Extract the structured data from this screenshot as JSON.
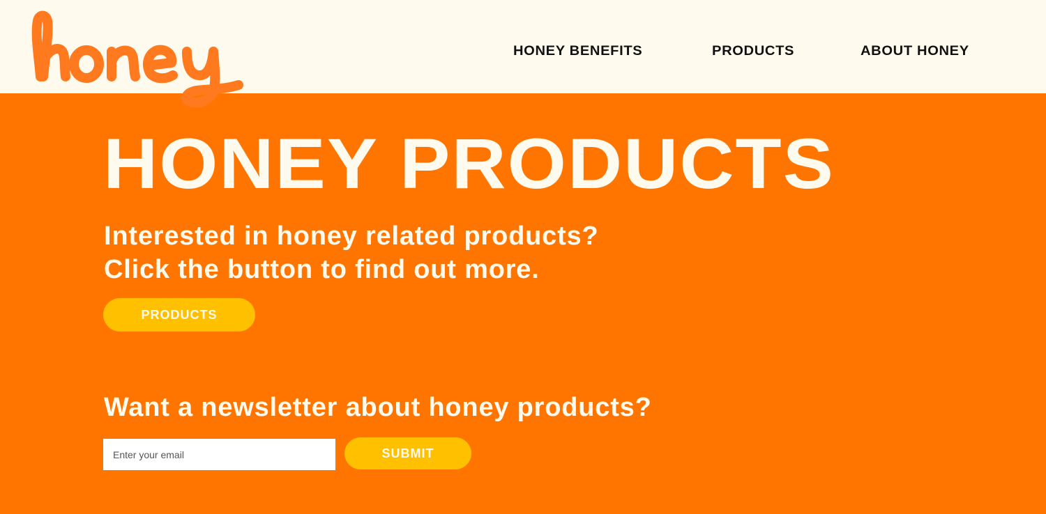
{
  "brand": {
    "logo_text": "honey",
    "logo_color": "#ff7a1f"
  },
  "nav": {
    "items": [
      {
        "label": "HONEY BENEFITS"
      },
      {
        "label": "PRODUCTS"
      },
      {
        "label": "ABOUT HONEY"
      }
    ]
  },
  "hero": {
    "title": "HONEY PRODUCTS",
    "subtitle_line1": "Interested in honey related products?",
    "subtitle_line2": "Click the button to find out more.",
    "button_label": "PRODUCTS"
  },
  "newsletter": {
    "title": "Want a newsletter about honey products?",
    "email_placeholder": "Enter your email",
    "email_value": "",
    "submit_label": "SUBMIT"
  },
  "colors": {
    "header_bg": "#fffaee",
    "page_bg": "#ff7500",
    "accent_button": "#ffc000",
    "text_light": "#fffaee",
    "text_dark": "#111111"
  }
}
